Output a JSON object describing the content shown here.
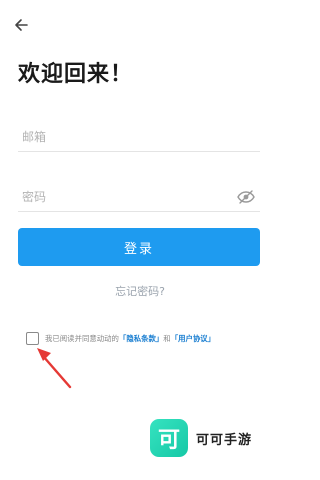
{
  "header": {
    "back_icon": "arrow-left-icon",
    "title": "欢迎回来！"
  },
  "form": {
    "email_placeholder": "邮箱",
    "email_value": "",
    "password_placeholder": "密码",
    "password_value": "",
    "visibility_icon": "eye-slash-icon",
    "login_label": "登录",
    "forgot_label": "忘记密码?"
  },
  "agreement": {
    "checked": false,
    "prefix": "我已阅读并同意动动的",
    "privacy_link": "「隐私条款」",
    "conjunction": "和",
    "terms_link": "「用户协议」"
  },
  "watermark": {
    "logo_char": "可",
    "name": "可可手游"
  },
  "colors": {
    "primary": "#1e9bf0",
    "link": "#1b7fd1",
    "arrow": "#e53935",
    "logo": "#1fd1ae"
  }
}
